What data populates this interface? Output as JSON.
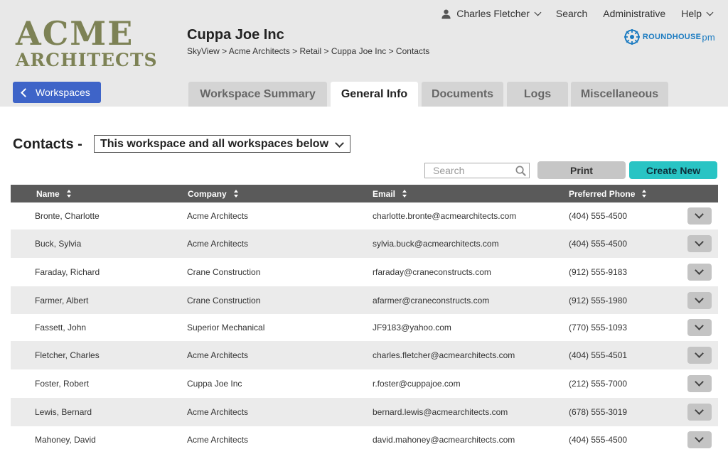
{
  "logo": {
    "line1": "ACME",
    "line2": "ARCHITECTS"
  },
  "workspace": {
    "title": "Cuppa Joe Inc",
    "breadcrumb": "SkyView > Acme Architects > Retail > Cuppa Joe Inc > Contacts"
  },
  "topnav": {
    "user": "Charles Fletcher",
    "search": "Search",
    "administrative": "Administrative",
    "help": "Help"
  },
  "brand": {
    "name": "ROUNDHOUSE",
    "suffix": "pm"
  },
  "workspaces_button": "Workspaces",
  "tabs": [
    {
      "label": "Workspace Summary",
      "active": false
    },
    {
      "label": "General Info",
      "active": true
    },
    {
      "label": "Documents",
      "active": false
    },
    {
      "label": "Logs",
      "active": false
    },
    {
      "label": "Miscellaneous",
      "active": false
    }
  ],
  "contacts": {
    "label": "Contacts -",
    "scope_selected": "This workspace and all workspaces below",
    "search_placeholder": "Search",
    "print_label": "Print",
    "create_label": "Create New",
    "columns": [
      "Name",
      "Company",
      "Email",
      "Preferred Phone"
    ],
    "rows": [
      [
        "Bronte, Charlotte",
        "Acme Architects",
        "charlotte.bronte@acmearchitects.com",
        "(404) 555-4500"
      ],
      [
        "Buck, Sylvia",
        "Acme Architects",
        "sylvia.buck@acmearchitects.com",
        "(404) 555-4500"
      ],
      [
        "Faraday, Richard",
        "Crane Construction",
        "rfaraday@craneconstructs.com",
        "(912) 555-9183"
      ],
      [
        "Farmer, Albert",
        "Crane Construction",
        "afarmer@craneconstructs.com",
        "(912) 555-1980"
      ],
      [
        "Fassett, John",
        "Superior Mechanical",
        "JF9183@yahoo.com",
        "(770) 555-1093"
      ],
      [
        "Fletcher, Charles",
        "Acme Architects",
        "charles.fletcher@acmearchitects.com",
        "(404) 555-4501"
      ],
      [
        "Foster, Robert",
        "Cuppa Joe Inc",
        "r.foster@cuppajoe.com",
        "(212) 555-7000"
      ],
      [
        "Lewis, Bernard",
        "Acme Architects",
        "bernard.lewis@acmearchitects.com",
        "(678) 555-3019"
      ],
      [
        "Mahoney, David",
        "Acme Architects",
        "david.mahoney@acmearchitects.com",
        "(404) 555-4500"
      ]
    ]
  },
  "colors": {
    "header_bg": "#e8e8e8",
    "logo_olive": "#7d8255",
    "workspaces_button": "#3e64c8",
    "create_button": "#29c4c4",
    "table_header": "#5a5a5a",
    "brand_blue": "#1b7bc1"
  }
}
